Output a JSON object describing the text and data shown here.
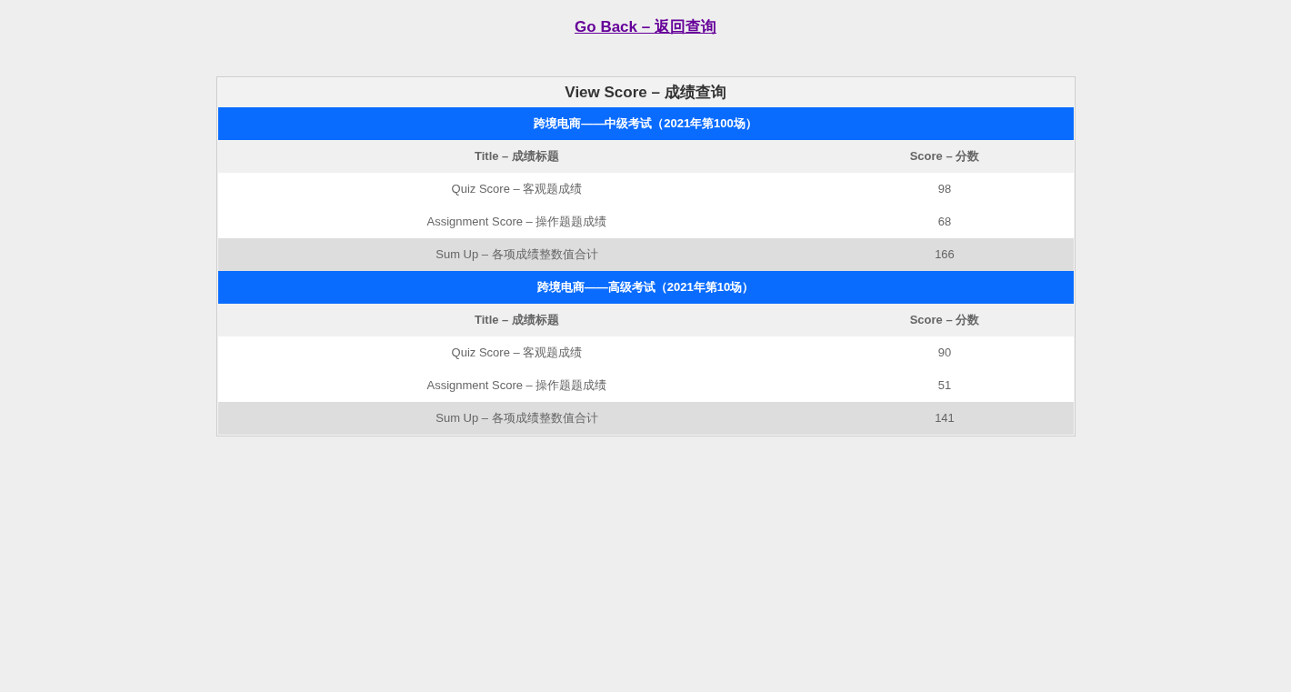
{
  "back_link": "Go Back – 返回查询",
  "table": {
    "title": "View Score – 成绩查询",
    "sections": [
      {
        "heading": "跨境电商——中级考试（2021年第100场）",
        "columns": [
          "Title – 成绩标题",
          "Score – 分数"
        ],
        "rows": [
          {
            "kind": "item",
            "cells": [
              "Quiz Score – 客观题成绩",
              "98"
            ]
          },
          {
            "kind": "item",
            "cells": [
              "Assignment Score – 操作题题成绩",
              "68"
            ]
          },
          {
            "kind": "total",
            "cells": [
              "Sum Up – 各项成绩整数值合计",
              "166"
            ]
          }
        ]
      },
      {
        "heading": "跨境电商——高级考试（2021年第10场）",
        "columns": [
          "Title – 成绩标题",
          "Score – 分数"
        ],
        "rows": [
          {
            "kind": "item",
            "cells": [
              "Quiz Score – 客观题成绩",
              "90"
            ]
          },
          {
            "kind": "item",
            "cells": [
              "Assignment Score – 操作题题成绩",
              "51"
            ]
          },
          {
            "kind": "total",
            "cells": [
              "Sum Up – 各项成绩整数值合计",
              "141"
            ]
          }
        ]
      }
    ]
  }
}
